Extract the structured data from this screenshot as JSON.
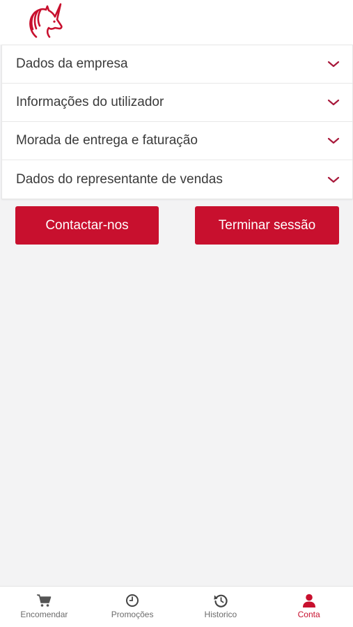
{
  "app": {
    "brand_color": "#c8102e",
    "logo_icon": "unicorn-icon"
  },
  "account": {
    "sections": [
      {
        "label": "Dados da empresa"
      },
      {
        "label": "Informações do utilizador"
      },
      {
        "label": "Morada de entrega e faturação"
      },
      {
        "label": "Dados do representante de vendas"
      }
    ],
    "contact_button": "Contactar-nos",
    "logout_button": "Terminar sessão"
  },
  "tabbar": {
    "items": [
      {
        "label": "Encomendar",
        "icon": "cart-icon",
        "active": false
      },
      {
        "label": "Promoções",
        "icon": "clock-icon",
        "active": false
      },
      {
        "label": "Historico",
        "icon": "history-icon",
        "active": false
      },
      {
        "label": "Conta",
        "icon": "user-icon",
        "active": true
      }
    ]
  }
}
